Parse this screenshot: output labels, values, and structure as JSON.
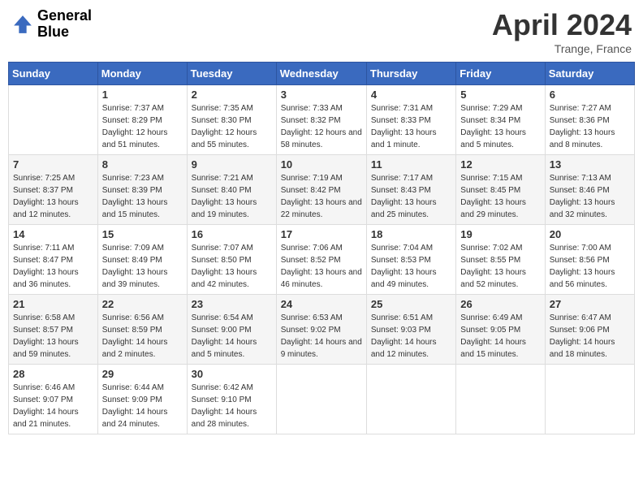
{
  "header": {
    "logo_line1": "General",
    "logo_line2": "Blue",
    "month_title": "April 2024",
    "location": "Trange, France"
  },
  "days_of_week": [
    "Sunday",
    "Monday",
    "Tuesday",
    "Wednesday",
    "Thursday",
    "Friday",
    "Saturday"
  ],
  "weeks": [
    [
      {
        "day": "",
        "sunrise": "",
        "sunset": "",
        "daylight": ""
      },
      {
        "day": "1",
        "sunrise": "Sunrise: 7:37 AM",
        "sunset": "Sunset: 8:29 PM",
        "daylight": "Daylight: 12 hours and 51 minutes."
      },
      {
        "day": "2",
        "sunrise": "Sunrise: 7:35 AM",
        "sunset": "Sunset: 8:30 PM",
        "daylight": "Daylight: 12 hours and 55 minutes."
      },
      {
        "day": "3",
        "sunrise": "Sunrise: 7:33 AM",
        "sunset": "Sunset: 8:32 PM",
        "daylight": "Daylight: 12 hours and 58 minutes."
      },
      {
        "day": "4",
        "sunrise": "Sunrise: 7:31 AM",
        "sunset": "Sunset: 8:33 PM",
        "daylight": "Daylight: 13 hours and 1 minute."
      },
      {
        "day": "5",
        "sunrise": "Sunrise: 7:29 AM",
        "sunset": "Sunset: 8:34 PM",
        "daylight": "Daylight: 13 hours and 5 minutes."
      },
      {
        "day": "6",
        "sunrise": "Sunrise: 7:27 AM",
        "sunset": "Sunset: 8:36 PM",
        "daylight": "Daylight: 13 hours and 8 minutes."
      }
    ],
    [
      {
        "day": "7",
        "sunrise": "Sunrise: 7:25 AM",
        "sunset": "Sunset: 8:37 PM",
        "daylight": "Daylight: 13 hours and 12 minutes."
      },
      {
        "day": "8",
        "sunrise": "Sunrise: 7:23 AM",
        "sunset": "Sunset: 8:39 PM",
        "daylight": "Daylight: 13 hours and 15 minutes."
      },
      {
        "day": "9",
        "sunrise": "Sunrise: 7:21 AM",
        "sunset": "Sunset: 8:40 PM",
        "daylight": "Daylight: 13 hours and 19 minutes."
      },
      {
        "day": "10",
        "sunrise": "Sunrise: 7:19 AM",
        "sunset": "Sunset: 8:42 PM",
        "daylight": "Daylight: 13 hours and 22 minutes."
      },
      {
        "day": "11",
        "sunrise": "Sunrise: 7:17 AM",
        "sunset": "Sunset: 8:43 PM",
        "daylight": "Daylight: 13 hours and 25 minutes."
      },
      {
        "day": "12",
        "sunrise": "Sunrise: 7:15 AM",
        "sunset": "Sunset: 8:45 PM",
        "daylight": "Daylight: 13 hours and 29 minutes."
      },
      {
        "day": "13",
        "sunrise": "Sunrise: 7:13 AM",
        "sunset": "Sunset: 8:46 PM",
        "daylight": "Daylight: 13 hours and 32 minutes."
      }
    ],
    [
      {
        "day": "14",
        "sunrise": "Sunrise: 7:11 AM",
        "sunset": "Sunset: 8:47 PM",
        "daylight": "Daylight: 13 hours and 36 minutes."
      },
      {
        "day": "15",
        "sunrise": "Sunrise: 7:09 AM",
        "sunset": "Sunset: 8:49 PM",
        "daylight": "Daylight: 13 hours and 39 minutes."
      },
      {
        "day": "16",
        "sunrise": "Sunrise: 7:07 AM",
        "sunset": "Sunset: 8:50 PM",
        "daylight": "Daylight: 13 hours and 42 minutes."
      },
      {
        "day": "17",
        "sunrise": "Sunrise: 7:06 AM",
        "sunset": "Sunset: 8:52 PM",
        "daylight": "Daylight: 13 hours and 46 minutes."
      },
      {
        "day": "18",
        "sunrise": "Sunrise: 7:04 AM",
        "sunset": "Sunset: 8:53 PM",
        "daylight": "Daylight: 13 hours and 49 minutes."
      },
      {
        "day": "19",
        "sunrise": "Sunrise: 7:02 AM",
        "sunset": "Sunset: 8:55 PM",
        "daylight": "Daylight: 13 hours and 52 minutes."
      },
      {
        "day": "20",
        "sunrise": "Sunrise: 7:00 AM",
        "sunset": "Sunset: 8:56 PM",
        "daylight": "Daylight: 13 hours and 56 minutes."
      }
    ],
    [
      {
        "day": "21",
        "sunrise": "Sunrise: 6:58 AM",
        "sunset": "Sunset: 8:57 PM",
        "daylight": "Daylight: 13 hours and 59 minutes."
      },
      {
        "day": "22",
        "sunrise": "Sunrise: 6:56 AM",
        "sunset": "Sunset: 8:59 PM",
        "daylight": "Daylight: 14 hours and 2 minutes."
      },
      {
        "day": "23",
        "sunrise": "Sunrise: 6:54 AM",
        "sunset": "Sunset: 9:00 PM",
        "daylight": "Daylight: 14 hours and 5 minutes."
      },
      {
        "day": "24",
        "sunrise": "Sunrise: 6:53 AM",
        "sunset": "Sunset: 9:02 PM",
        "daylight": "Daylight: 14 hours and 9 minutes."
      },
      {
        "day": "25",
        "sunrise": "Sunrise: 6:51 AM",
        "sunset": "Sunset: 9:03 PM",
        "daylight": "Daylight: 14 hours and 12 minutes."
      },
      {
        "day": "26",
        "sunrise": "Sunrise: 6:49 AM",
        "sunset": "Sunset: 9:05 PM",
        "daylight": "Daylight: 14 hours and 15 minutes."
      },
      {
        "day": "27",
        "sunrise": "Sunrise: 6:47 AM",
        "sunset": "Sunset: 9:06 PM",
        "daylight": "Daylight: 14 hours and 18 minutes."
      }
    ],
    [
      {
        "day": "28",
        "sunrise": "Sunrise: 6:46 AM",
        "sunset": "Sunset: 9:07 PM",
        "daylight": "Daylight: 14 hours and 21 minutes."
      },
      {
        "day": "29",
        "sunrise": "Sunrise: 6:44 AM",
        "sunset": "Sunset: 9:09 PM",
        "daylight": "Daylight: 14 hours and 24 minutes."
      },
      {
        "day": "30",
        "sunrise": "Sunrise: 6:42 AM",
        "sunset": "Sunset: 9:10 PM",
        "daylight": "Daylight: 14 hours and 28 minutes."
      },
      {
        "day": "",
        "sunrise": "",
        "sunset": "",
        "daylight": ""
      },
      {
        "day": "",
        "sunrise": "",
        "sunset": "",
        "daylight": ""
      },
      {
        "day": "",
        "sunrise": "",
        "sunset": "",
        "daylight": ""
      },
      {
        "day": "",
        "sunrise": "",
        "sunset": "",
        "daylight": ""
      }
    ]
  ]
}
